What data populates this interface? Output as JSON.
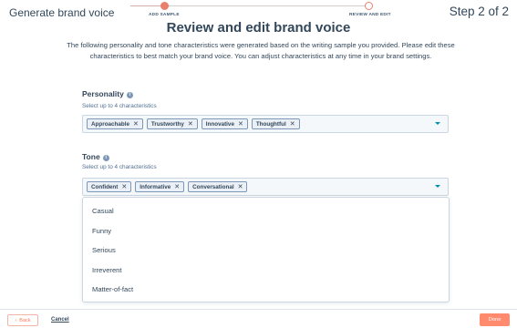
{
  "header": {
    "title": "Generate brand voice",
    "step": "Step 2 of 2",
    "progress": [
      {
        "label": "ADD SAMPLE"
      },
      {
        "label": "REVIEW AND EDIT"
      }
    ]
  },
  "main": {
    "title": "Review and edit brand voice",
    "intro": "The following personality and tone characteristics were generated based on the writing sample you provided.  Please edit these characteristics to best match your brand voice. You can adjust characteristics at any time in your brand settings.",
    "personality": {
      "label": "Personality",
      "hint": "Select up to 4 characteristics",
      "tags": [
        "Approachable",
        "Trustworthy",
        "Innovative",
        "Thoughtful"
      ]
    },
    "tone": {
      "label": "Tone",
      "hint": "Select up to 4 characteristics",
      "tags": [
        "Confident",
        "Informative",
        "Conversational"
      ],
      "options": [
        "Casual",
        "Funny",
        "Serious",
        "Irreverent",
        "Matter-of-fact"
      ]
    }
  },
  "footer": {
    "back": "Back",
    "cancel": "Cancel",
    "done": "Done"
  },
  "colors": {
    "accent": "#ff7a59",
    "text": "#33475b",
    "link": "#0091ae"
  }
}
